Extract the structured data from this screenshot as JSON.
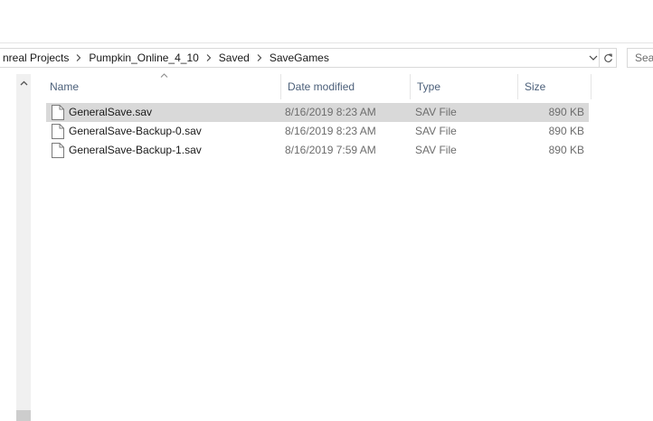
{
  "address": {
    "breadcrumbs": [
      "nreal Projects",
      "Pumpkin_Online_4_10",
      "Saved",
      "SaveGames"
    ]
  },
  "search": {
    "placeholder": "Sear"
  },
  "columns": [
    {
      "key": "name",
      "label": "Name"
    },
    {
      "key": "date",
      "label": "Date modified"
    },
    {
      "key": "type",
      "label": "Type"
    },
    {
      "key": "size",
      "label": "Size"
    }
  ],
  "files": [
    {
      "name": "GeneralSave.sav",
      "date": "8/16/2019 8:23 AM",
      "type": "SAV File",
      "size": "890 KB",
      "selected": true
    },
    {
      "name": "GeneralSave-Backup-0.sav",
      "date": "8/16/2019 8:23 AM",
      "type": "SAV File",
      "size": "890 KB",
      "selected": false
    },
    {
      "name": "GeneralSave-Backup-1.sav",
      "date": "8/16/2019 7:59 AM",
      "type": "SAV File",
      "size": "890 KB",
      "selected": false
    }
  ],
  "icons": {
    "breadcrumb_separator": "chevron-right-icon",
    "address_dropdown": "chevron-down-icon",
    "refresh": "refresh-icon",
    "sort": "sort-ascending-icon",
    "file": "file-icon",
    "scroll_up": "chevron-up-icon"
  },
  "colors": {
    "selection": "#d9d9d9",
    "header_text": "#4c607a",
    "detail_text": "#6d6d6d"
  }
}
